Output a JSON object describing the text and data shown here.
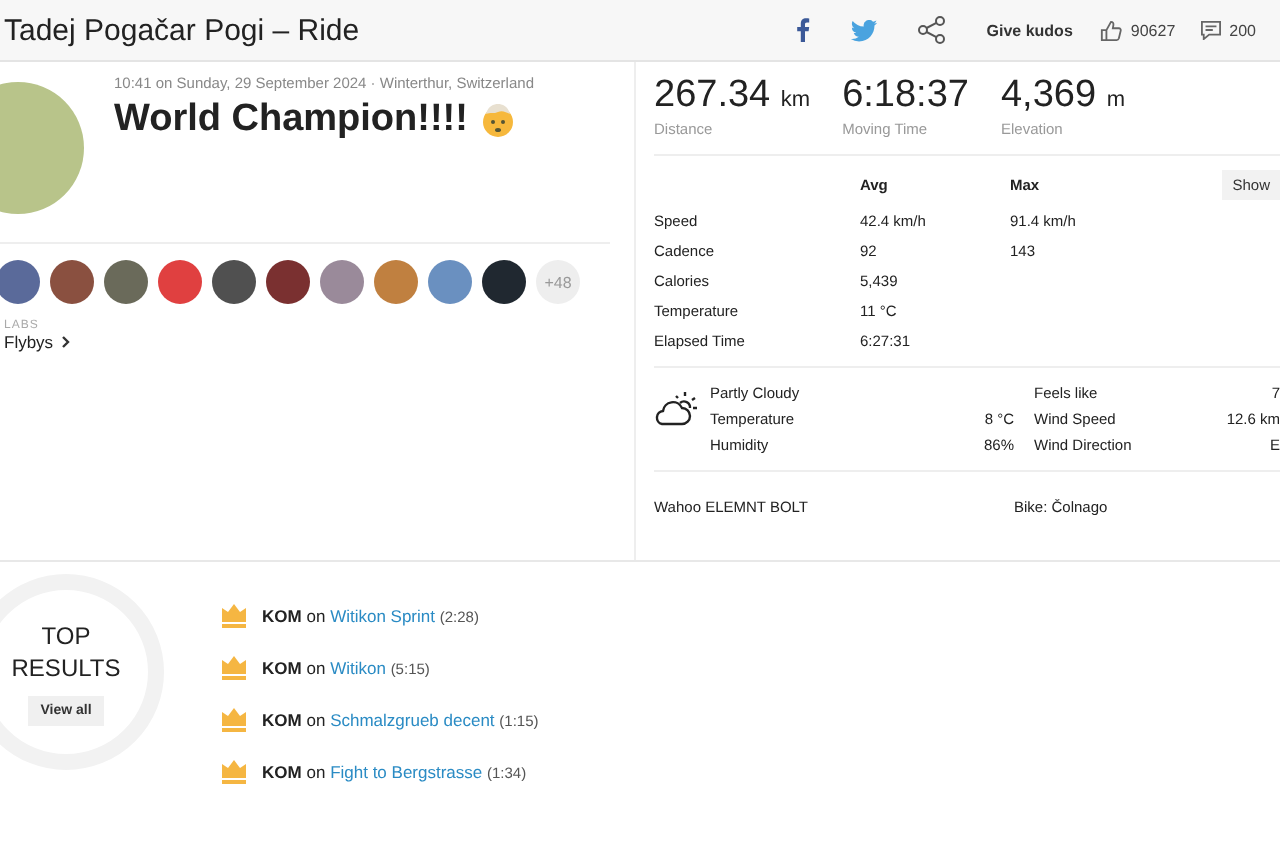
{
  "header": {
    "title": "Tadej Pogačar Pogi – Ride",
    "give_kudos": "Give kudos",
    "kudos_count": "90627",
    "comment_count": "200"
  },
  "activity": {
    "meta": "10:41 on Sunday, 29 September 2024 · Winterthur, Switzerland",
    "title": "World Champion!!!!",
    "more_kudos": "+48",
    "labs_label": "LABS",
    "flybys": "Flybys"
  },
  "stats": [
    {
      "value": "267.34",
      "unit": "km",
      "label": "Distance"
    },
    {
      "value": "6:18:37",
      "label": "Moving Time"
    },
    {
      "value": "4,369",
      "unit": "m",
      "label": "Elevation"
    }
  ],
  "details": {
    "columns": [
      "Avg",
      "Max"
    ],
    "show_button": "Show",
    "rows": [
      {
        "label": "Speed",
        "avg": "42.4 km/h",
        "max": "91.4 km/h"
      },
      {
        "label": "Cadence",
        "avg": "92",
        "max": "143"
      },
      {
        "label": "Calories",
        "avg": "5,439"
      },
      {
        "label": "Temperature",
        "avg": "11 °C"
      },
      {
        "label": "Elapsed Time",
        "avg": "6:27:31"
      }
    ]
  },
  "weather": {
    "condition": "Partly Cloudy",
    "left": [
      {
        "label": "Temperature",
        "value": "8 °C"
      },
      {
        "label": "Humidity",
        "value": "86%"
      }
    ],
    "right": [
      {
        "label": "Feels like",
        "value": "7"
      },
      {
        "label": "Wind Speed",
        "value": "12.6 km"
      },
      {
        "label": "Wind Direction",
        "value": "E"
      }
    ]
  },
  "device": "Wahoo ELEMNT BOLT",
  "bike": "Bike: Čolnago",
  "top_results": {
    "title_line1": "TOP",
    "title_line2": "RESULTS",
    "view_all": "View all",
    "items": [
      {
        "award": "KOM",
        "joiner": "on",
        "segment": "Witikon Sprint",
        "time": "(2:28)"
      },
      {
        "award": "KOM",
        "joiner": "on",
        "segment": "Witikon",
        "time": "(5:15)"
      },
      {
        "award": "KOM",
        "joiner": "on",
        "segment": "Schmalzgrueb decent",
        "time": "(1:15)"
      },
      {
        "award": "KOM",
        "joiner": "on",
        "segment": "Fight to Bergstrasse",
        "time": "(1:34)"
      }
    ]
  }
}
